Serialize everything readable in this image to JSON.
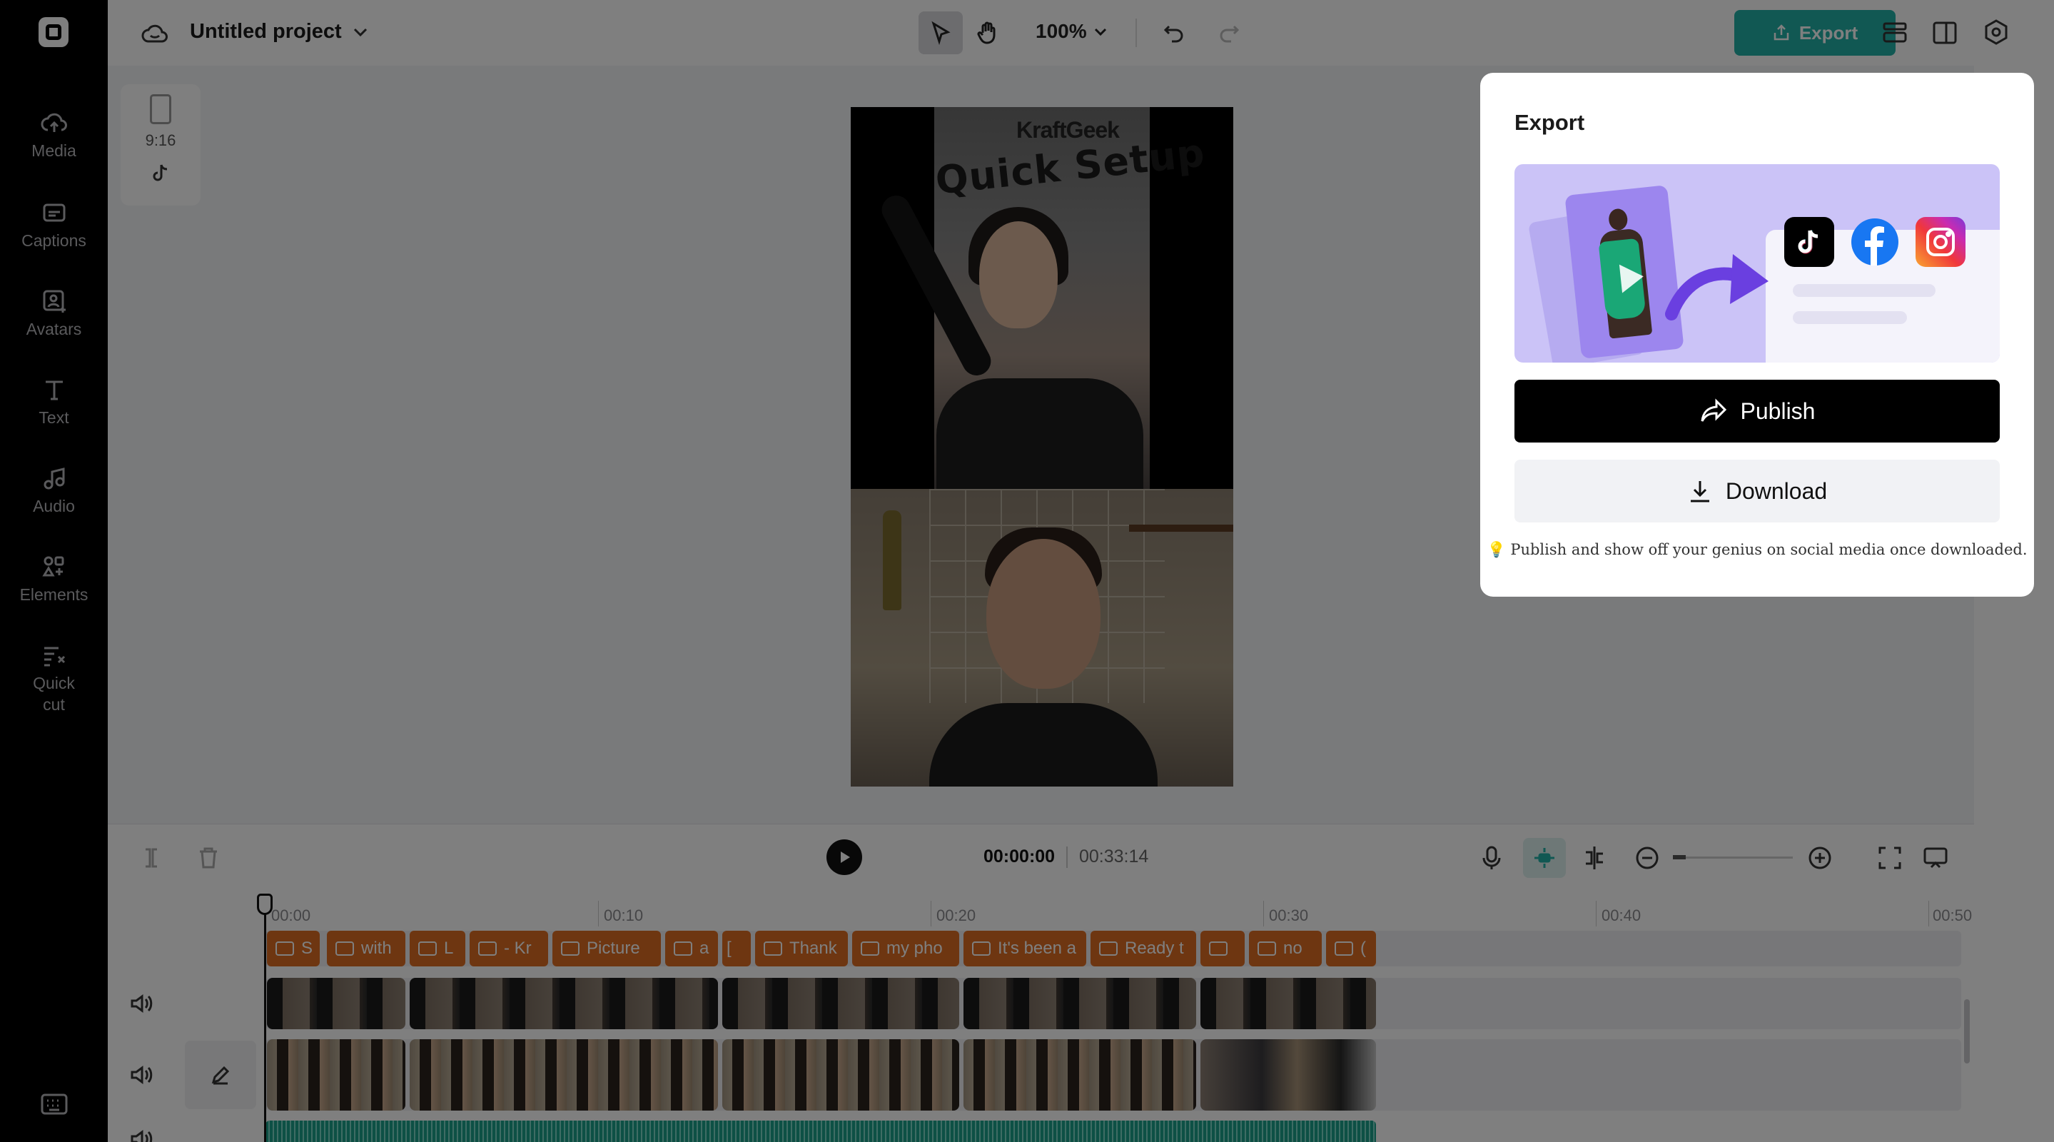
{
  "sidebar": {
    "items": [
      {
        "label": "Media",
        "icon": "cloud-upload-icon"
      },
      {
        "label": "Captions",
        "icon": "captions-icon"
      },
      {
        "label": "Avatars",
        "icon": "avatar-icon"
      },
      {
        "label": "Text",
        "icon": "text-icon"
      },
      {
        "label": "Audio",
        "icon": "music-note-icon"
      },
      {
        "label": "Elements",
        "icon": "elements-icon"
      },
      {
        "label": "Quick cut",
        "icon": "quick-cut-icon"
      }
    ]
  },
  "header": {
    "project_title": "Untitled project",
    "zoom": "100%",
    "export_label": "Export"
  },
  "canvas": {
    "aspect_ratio": "9:16",
    "video_brand_text": "KraftGeek",
    "video_title_text": "Quick Setup"
  },
  "timeline": {
    "current_time": "00:00:00",
    "total_time": "00:33:14",
    "ruler": [
      "00:00",
      "00:10",
      "00:20",
      "00:30",
      "00:40",
      "00:50"
    ],
    "caption_clips": [
      "S",
      "with",
      "L",
      "- Kr",
      "Picture",
      "a",
      "[",
      "Thank",
      "my pho",
      "It's been a",
      "Ready t",
      "",
      "no",
      "("
    ]
  },
  "export_dialog": {
    "title": "Export",
    "publish_label": "Publish",
    "download_label": "Download",
    "note": "Publish and show off your genius on social media once downloaded.",
    "social_platforms": [
      "tiktok",
      "facebook",
      "instagram"
    ]
  },
  "colors": {
    "accent": "#23b0a6",
    "caption_clip": "#dc6d23",
    "audio_clip": "#1aa08b",
    "banner": "#cbc3f7"
  }
}
